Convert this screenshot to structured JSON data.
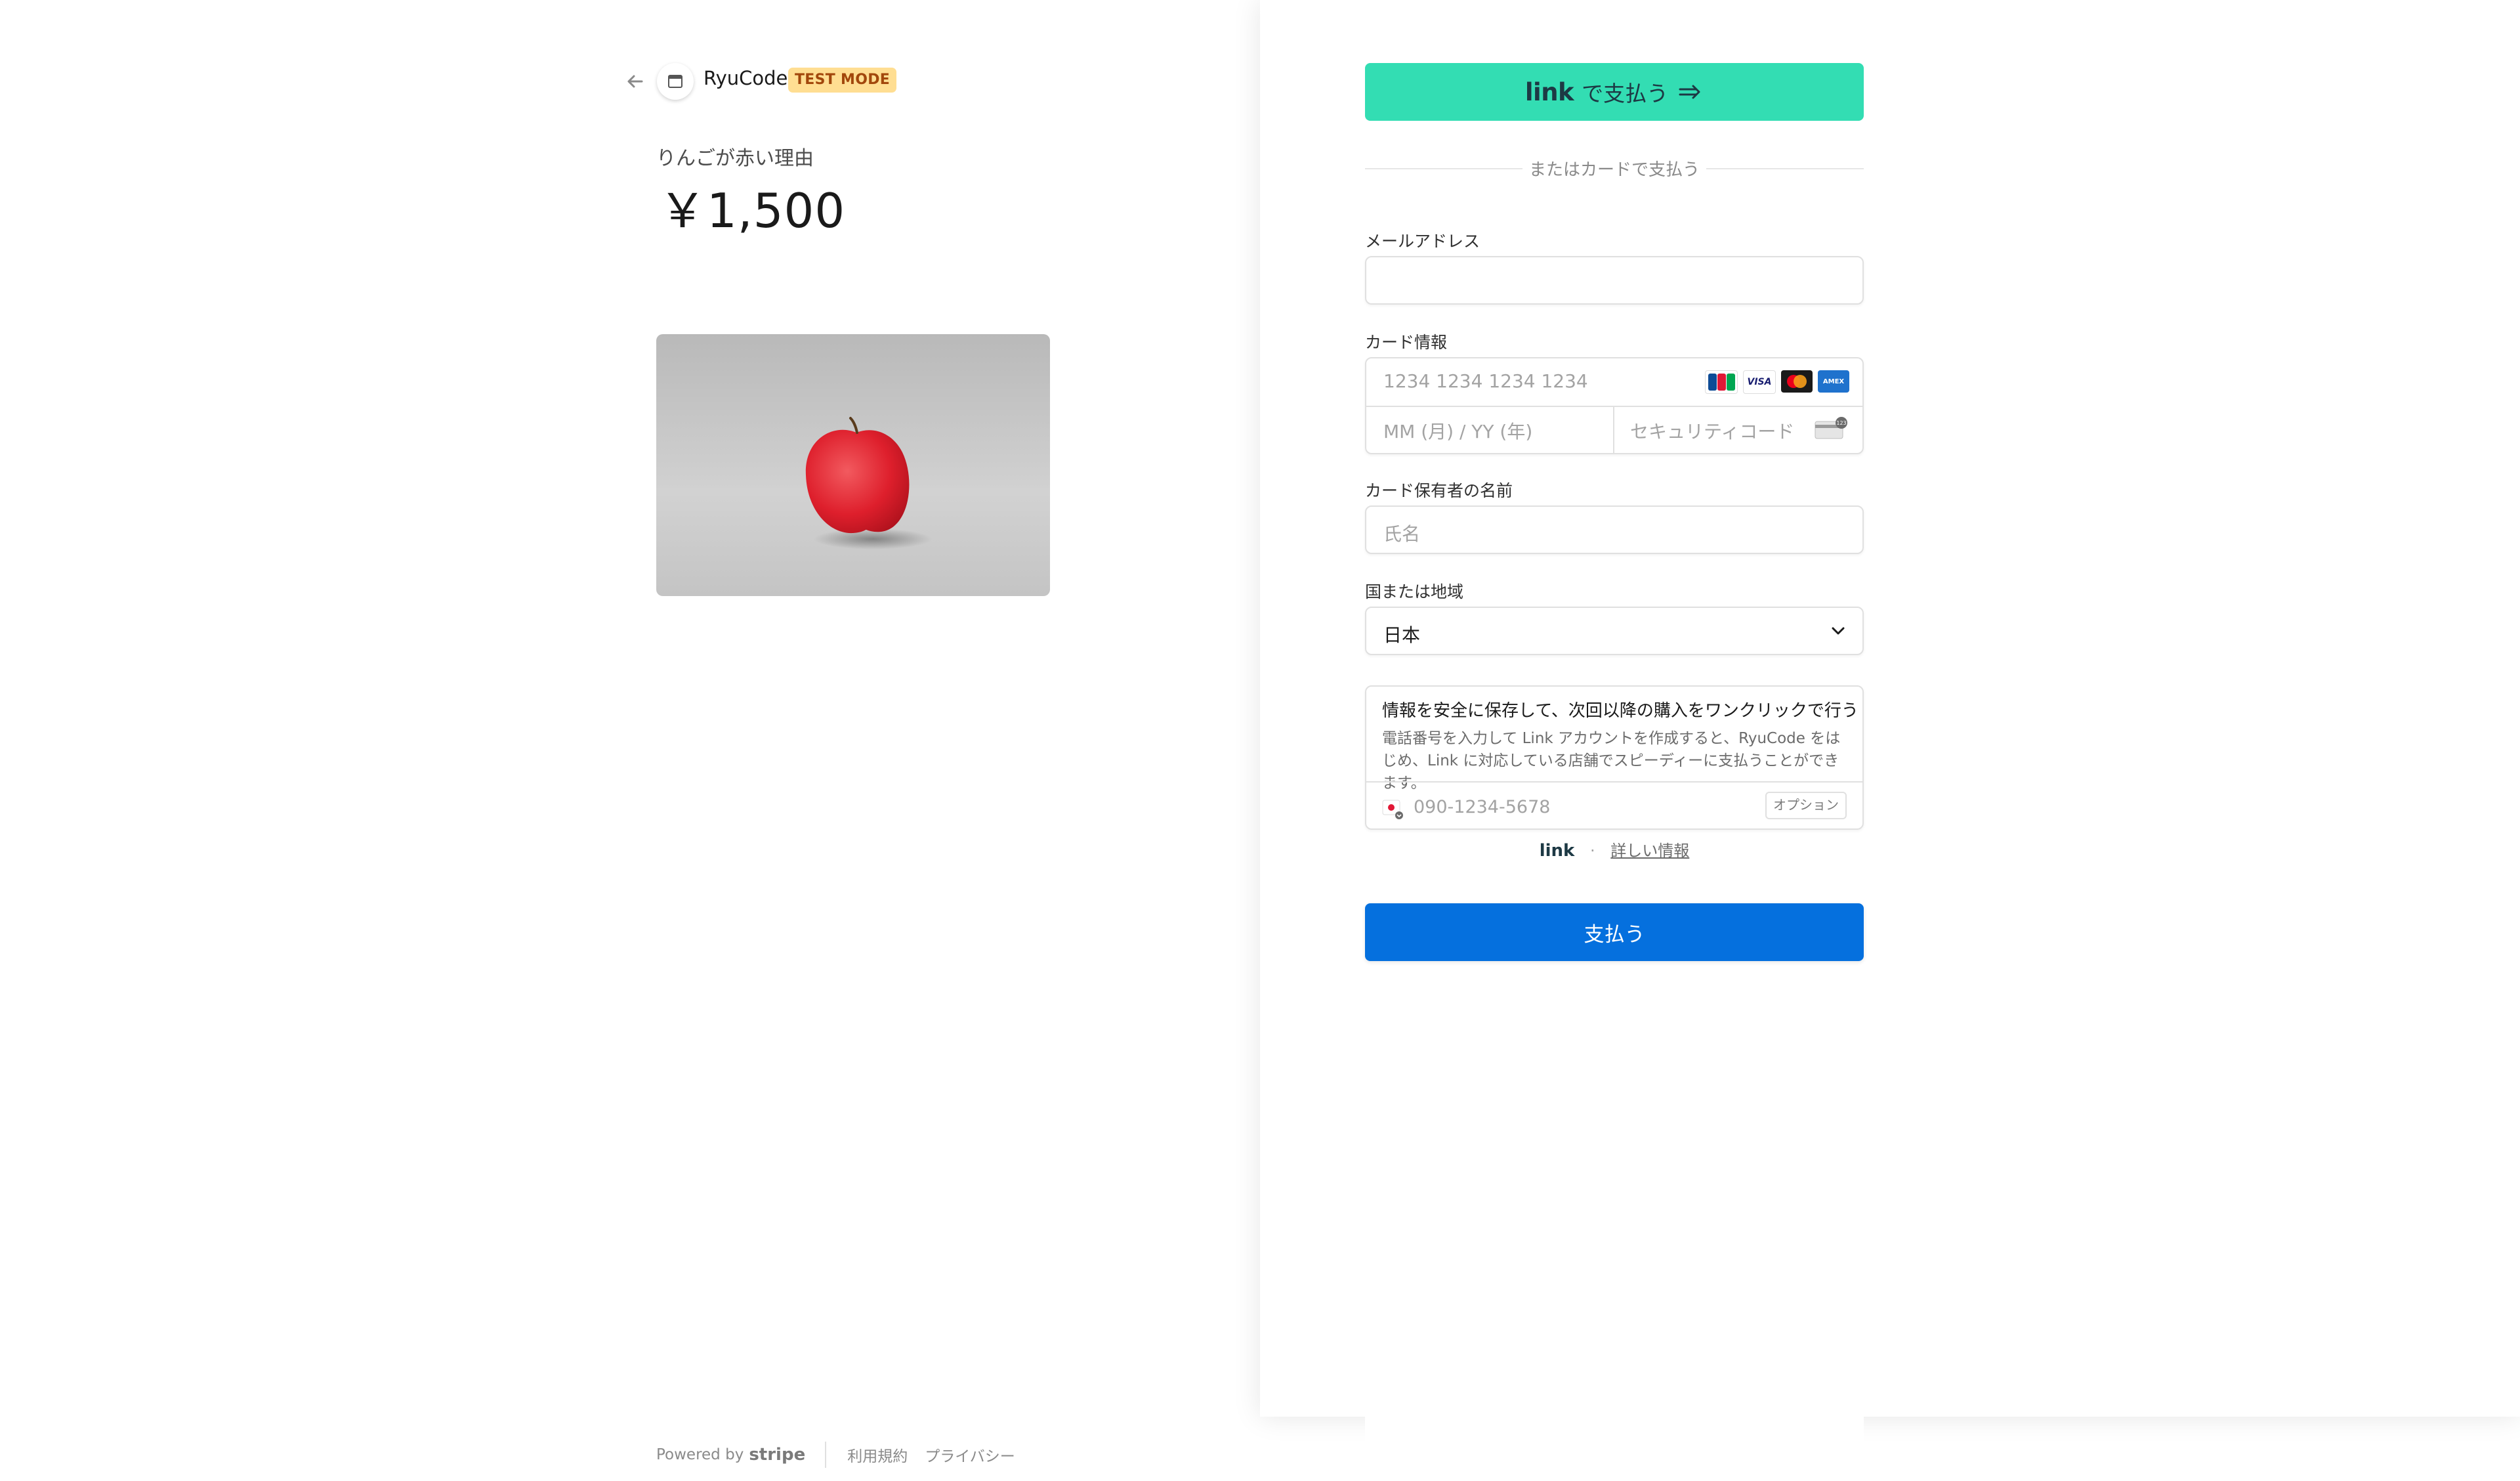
{
  "merchant": {
    "name": "RyuCode",
    "test_badge": "TEST MODE"
  },
  "product": {
    "name": "りんごが赤い理由",
    "price": "￥1,500"
  },
  "footer": {
    "powered_by": "Powered by",
    "stripe": "stripe",
    "terms": "利用規約",
    "privacy": "プライバシー"
  },
  "link_button": {
    "logo": "link",
    "label": "で支払う"
  },
  "or_divider": "またはカードで支払う",
  "email": {
    "label": "メールアドレス",
    "value": ""
  },
  "card": {
    "label": "カード情報",
    "number_placeholder": "1234 1234 1234 1234",
    "expiry_placeholder": "MM (月) / YY (年)",
    "cvc_placeholder": "セキュリティコード",
    "brands": [
      "JCB",
      "VISA",
      "Mastercard",
      "Amex"
    ]
  },
  "cardholder": {
    "label": "カード保有者の名前",
    "placeholder": "氏名"
  },
  "country": {
    "label": "国または地域",
    "value": "日本"
  },
  "save_info": {
    "title": "情報を安全に保存して、次回以降の購入をワンクリックで行う",
    "description": "電話番号を入力して Link アカウントを作成すると、RyuCode をはじめ、Link に対応している店舗でスピーディーに支払うことができます。",
    "phone_placeholder": "090-1234-5678",
    "optional": "オプション"
  },
  "link_info": {
    "logo": "link",
    "separator": "·",
    "more": "詳しい情報"
  },
  "pay_button": "支払う",
  "colors": {
    "link_green": "#33ddb3",
    "pay_blue": "#0570de",
    "badge_bg": "#ffde92",
    "badge_text": "#a2470b"
  }
}
